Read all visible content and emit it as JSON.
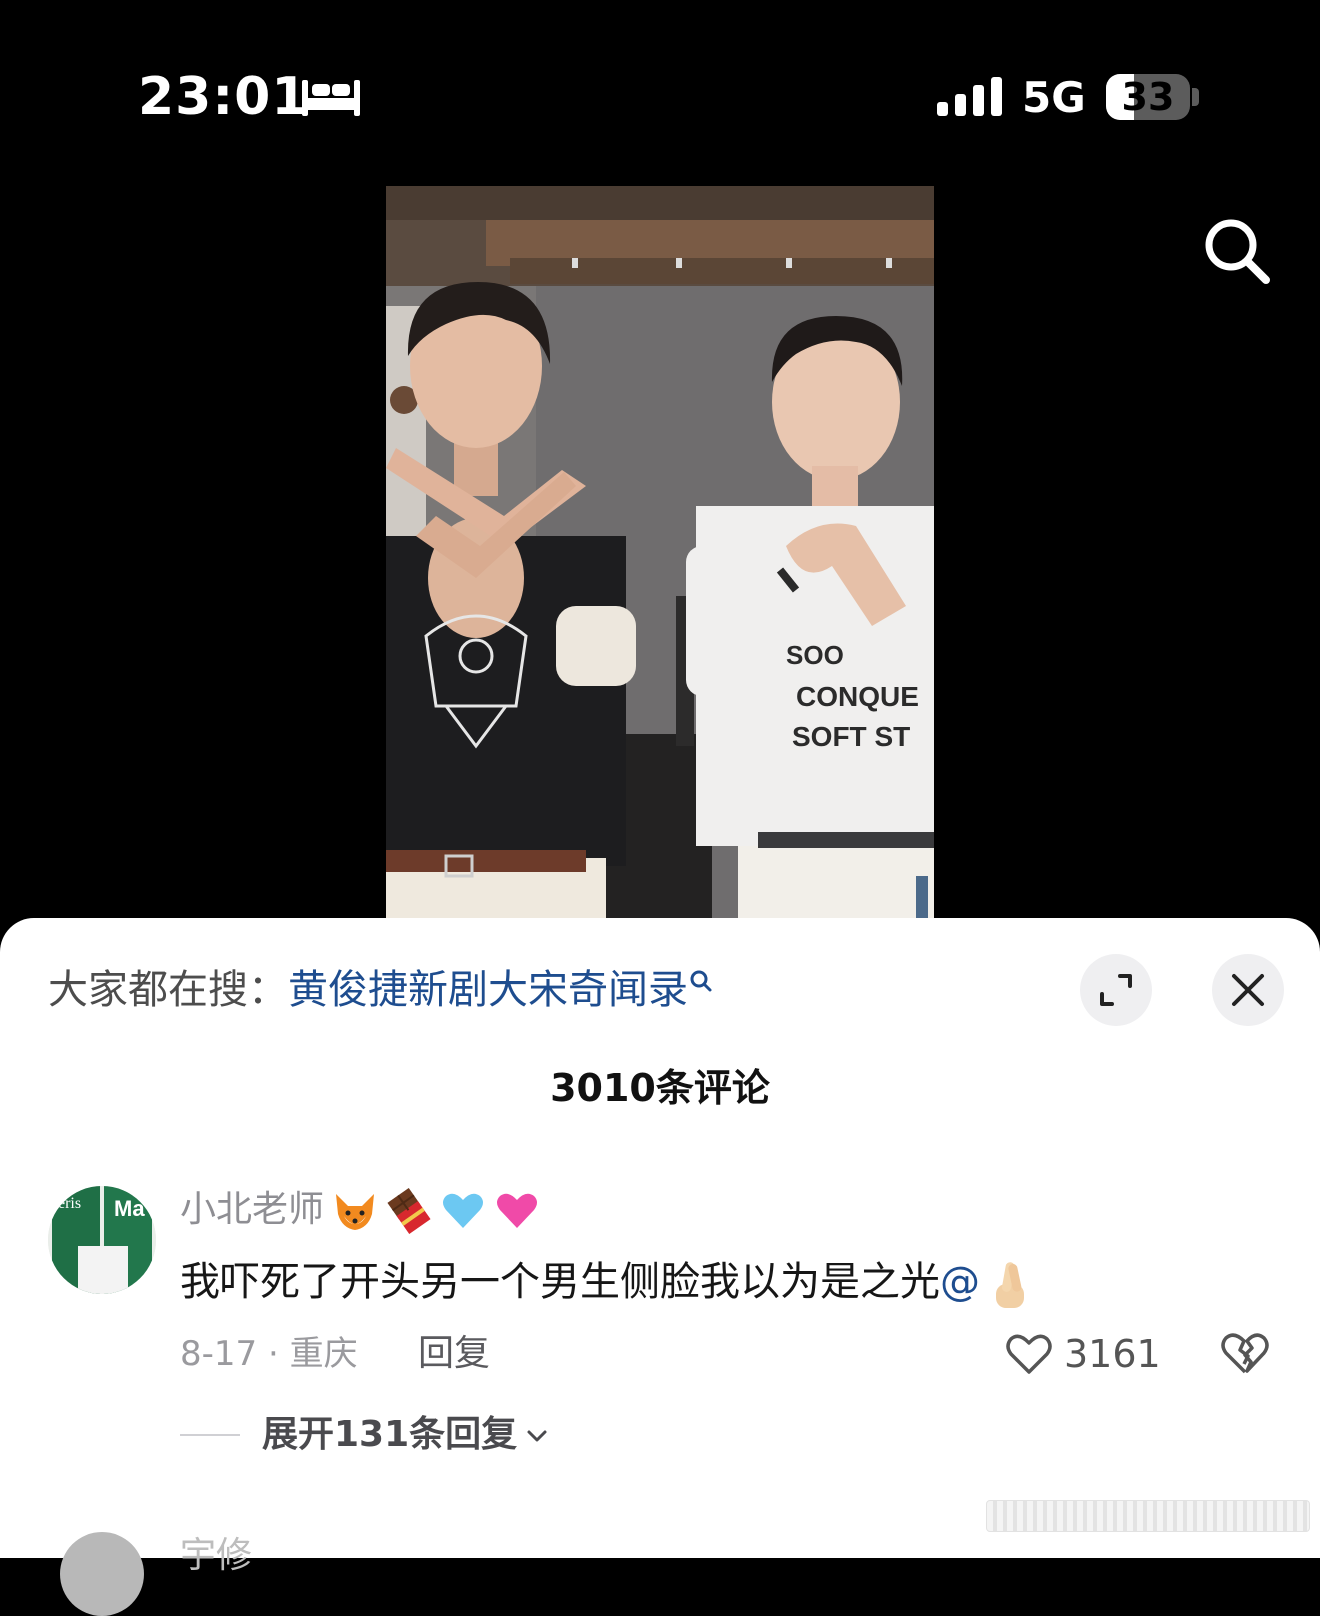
{
  "status_bar": {
    "time": "23:01",
    "network": "5G",
    "battery_level": "33",
    "battery_fraction": 0.33,
    "icons": [
      "sleep-bed-icon",
      "signal-bars-icon",
      "battery-icon"
    ]
  },
  "top": {
    "search_icon": "search-icon"
  },
  "sheet": {
    "hot_search_prefix": "大家都在搜：",
    "hot_search_query": "黄俊捷新剧大宋奇闻录",
    "expand_icon": "expand-icon",
    "close_icon": "close-icon",
    "comment_count": "3010条评论"
  },
  "comment": {
    "username": "小北老师",
    "username_emojis": [
      "fox-emoji",
      "chocolate-emoji",
      "light-blue-heart-emoji",
      "pink-heart-emoji"
    ],
    "text": "我吓死了开头另一个男生侧脸我以为是之光",
    "mention": "@",
    "trailing_emoji": "crossed-fingers-emoji",
    "date_location": "8-17 · 重庆",
    "reply_label": "回复",
    "likes": "3161",
    "expand_replies_label": "展开131条回复"
  },
  "next_comment": {
    "username_partial": "宇修"
  },
  "colors": {
    "link": "#1e4d8f",
    "background": "#000000",
    "sheet": "#ffffff"
  }
}
